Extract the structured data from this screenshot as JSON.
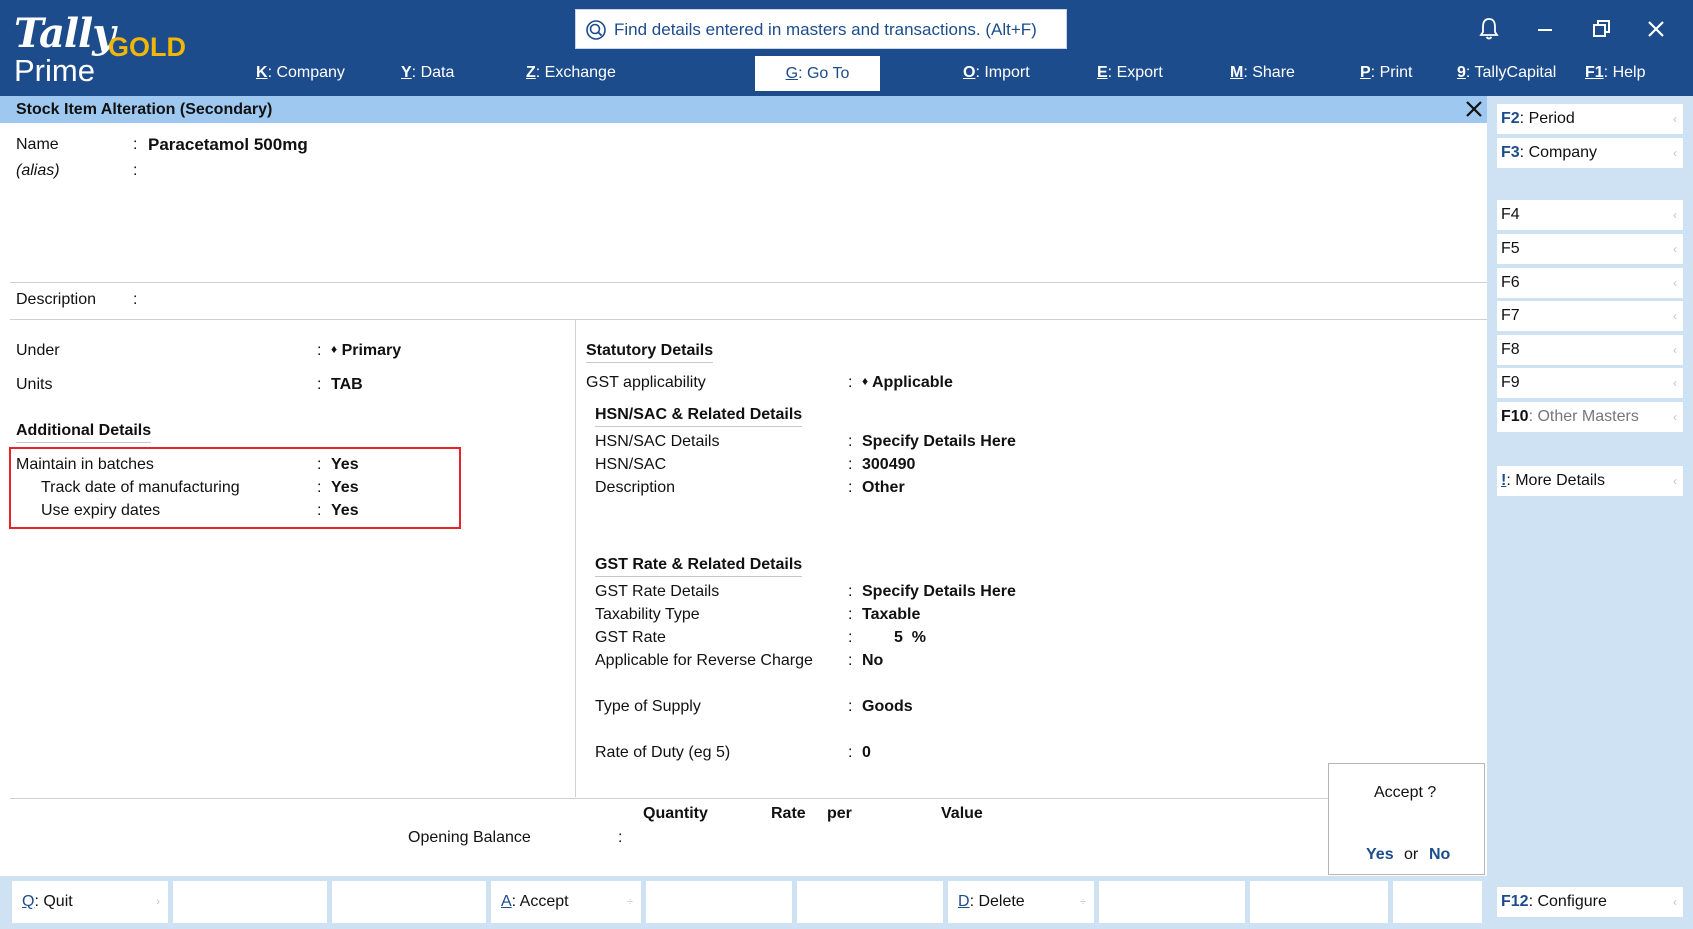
{
  "header": {
    "logo_tally": "Tally",
    "logo_gold": "GOLD",
    "logo_prime": "Prime",
    "search_placeholder": "Find details entered in masters and transactions. (Alt+F)",
    "menu": [
      {
        "key": "K",
        "label": ": Company"
      },
      {
        "key": "Y",
        "label": ": Data"
      },
      {
        "key": "Z",
        "label": ": Exchange"
      },
      {
        "key": "G",
        "label": ": Go To"
      },
      {
        "key": "O",
        "label": ": Import"
      },
      {
        "key": "E",
        "label": ": Export"
      },
      {
        "key": "M",
        "label": ": Share"
      },
      {
        "key": "P",
        "label": ": Print"
      },
      {
        "key": "9",
        "label": ": TallyCapital"
      },
      {
        "key": "F1",
        "label": ": Help"
      }
    ]
  },
  "title": "Stock Item Alteration (Secondary)",
  "item": {
    "name_label": "Name",
    "name_value": "Paracetamol 500mg",
    "alias_label": "(alias)",
    "description_label": "Description"
  },
  "left": {
    "under_label": "Under",
    "under_value": "Primary",
    "units_label": "Units",
    "units_value": "TAB",
    "additional_heading": "Additional Details",
    "batches_label": "Maintain in batches",
    "batches_value": "Yes",
    "mfg_label": "Track date of manufacturing",
    "mfg_value": "Yes",
    "expiry_label": "Use expiry dates",
    "expiry_value": "Yes"
  },
  "statutory": {
    "heading": "Statutory Details",
    "gst_app_label": "GST applicability",
    "gst_app_value": "Applicable",
    "hsn_heading": "HSN/SAC & Related Details",
    "hsn_details_label": "HSN/SAC Details",
    "hsn_details_value": "Specify Details Here",
    "hsn_label": "HSN/SAC",
    "hsn_value": "300490",
    "desc_label": "Description",
    "desc_value": "Other",
    "gst_heading": "GST Rate & Related Details",
    "rate_details_label": "GST Rate Details",
    "rate_details_value": "Specify Details Here",
    "taxability_label": "Taxability Type",
    "taxability_value": "Taxable",
    "gst_rate_label": "GST Rate",
    "gst_rate_value": "5",
    "gst_rate_unit": "%",
    "reverse_label": "Applicable for Reverse Charge",
    "reverse_value": "No",
    "supply_label": "Type of Supply",
    "supply_value": "Goods",
    "duty_label": "Rate of Duty (eg 5)",
    "duty_value": "0"
  },
  "opening": {
    "quantity": "Quantity",
    "rate": "Rate",
    "per": "per",
    "value": "Value",
    "label": "Opening Balance"
  },
  "accept": {
    "question": "Accept ?",
    "yes": "Yes",
    "or": "or",
    "no": "No"
  },
  "rightpanel": {
    "f2_key": "F2",
    "f2_label": ": Period",
    "f3_key": "F3",
    "f3_label": ": Company",
    "f4": "F4",
    "f5": "F5",
    "f6": "F6",
    "f7": "F7",
    "f8": "F8",
    "f9": "F9",
    "f10_key": "F10",
    "f10_label": ": Other Masters",
    "more_key": "!",
    "more_label": ": More Details",
    "f12_key": "F12",
    "f12_label": ": Configure"
  },
  "bottom": {
    "quit_key": "Q",
    "quit_label": ": Quit",
    "accept_key": "A",
    "accept_label": ": Accept",
    "delete_key": "D",
    "delete_label": ": Delete"
  },
  "colors": {
    "header_bg": "#1d4c8c",
    "titlebar_bg": "#9ec8ef",
    "panel_bg": "#cfe2f4",
    "accent_gold": "#f2b705",
    "highlight_red": "#e8242a"
  }
}
